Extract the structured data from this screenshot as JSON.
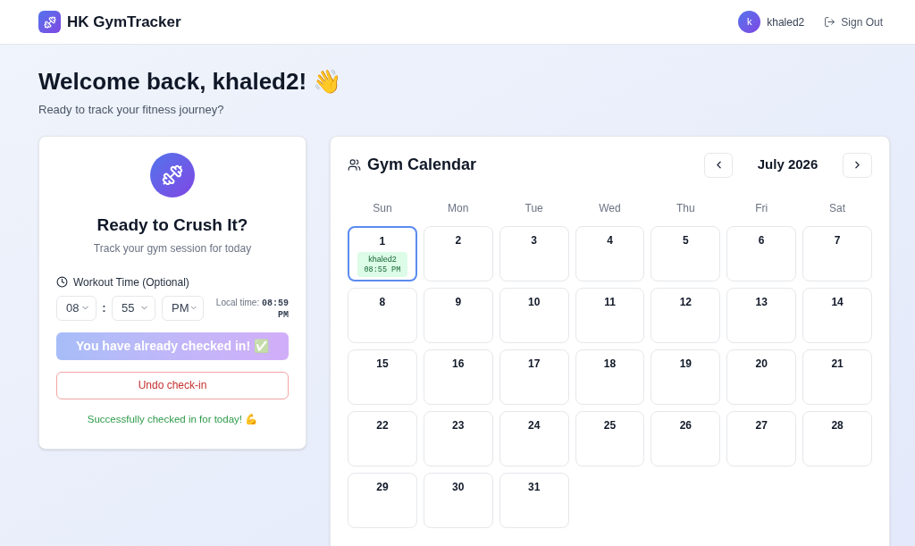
{
  "header": {
    "app_name": "HK GymTracker",
    "user": {
      "initial": "k",
      "name": "khaled2"
    },
    "sign_out": "Sign Out"
  },
  "welcome": {
    "title": "Welcome back, khaled2! 👋",
    "subtitle": "Ready to track your fitness journey?"
  },
  "checkin_card": {
    "title": "Ready to Crush It?",
    "subtitle": "Track your gym session for today",
    "time_label": "Workout Time (Optional)",
    "hour": "08",
    "separator": ":",
    "minute": "55",
    "period": "PM",
    "local_time_label": "Local time:",
    "local_time": "08:59 PM",
    "status_button": {
      "label": "You have already checked in! ✅",
      "disabled": true
    },
    "undo_button": "Undo check-in",
    "success_message": "Successfully checked in for today! 💪"
  },
  "calendar": {
    "title": "Gym Calendar",
    "month_label": "July 2026",
    "weekdays": [
      "Sun",
      "Mon",
      "Tue",
      "Wed",
      "Thu",
      "Fri",
      "Sat"
    ],
    "days": [
      {
        "label": "1",
        "selected": true,
        "entries": [
          {
            "name": "khaled2",
            "time": "08:55 PM"
          }
        ]
      },
      {
        "label": "2",
        "selected": false
      },
      {
        "label": "3",
        "selected": false
      },
      {
        "label": "4",
        "selected": false
      },
      {
        "label": "5",
        "selected": false
      },
      {
        "label": "6",
        "selected": false
      },
      {
        "label": "7",
        "selected": false
      },
      {
        "label": "8",
        "selected": false
      },
      {
        "label": "9",
        "selected": false
      },
      {
        "label": "10",
        "selected": false
      },
      {
        "label": "11",
        "selected": false
      },
      {
        "label": "12",
        "selected": false
      },
      {
        "label": "13",
        "selected": false
      },
      {
        "label": "14",
        "selected": false
      },
      {
        "label": "15",
        "selected": false
      },
      {
        "label": "16",
        "selected": false
      },
      {
        "label": "17",
        "selected": false
      },
      {
        "label": "18",
        "selected": false
      },
      {
        "label": "19",
        "selected": false
      },
      {
        "label": "20",
        "selected": false
      },
      {
        "label": "21",
        "selected": false
      },
      {
        "label": "22",
        "selected": false
      },
      {
        "label": "23",
        "selected": false
      },
      {
        "label": "24",
        "selected": false
      },
      {
        "label": "25",
        "selected": false
      },
      {
        "label": "26",
        "selected": false
      },
      {
        "label": "27",
        "selected": false
      },
      {
        "label": "28",
        "selected": false
      },
      {
        "label": "29",
        "selected": false
      },
      {
        "label": "30",
        "selected": false
      },
      {
        "label": "31",
        "selected": false
      }
    ]
  }
}
